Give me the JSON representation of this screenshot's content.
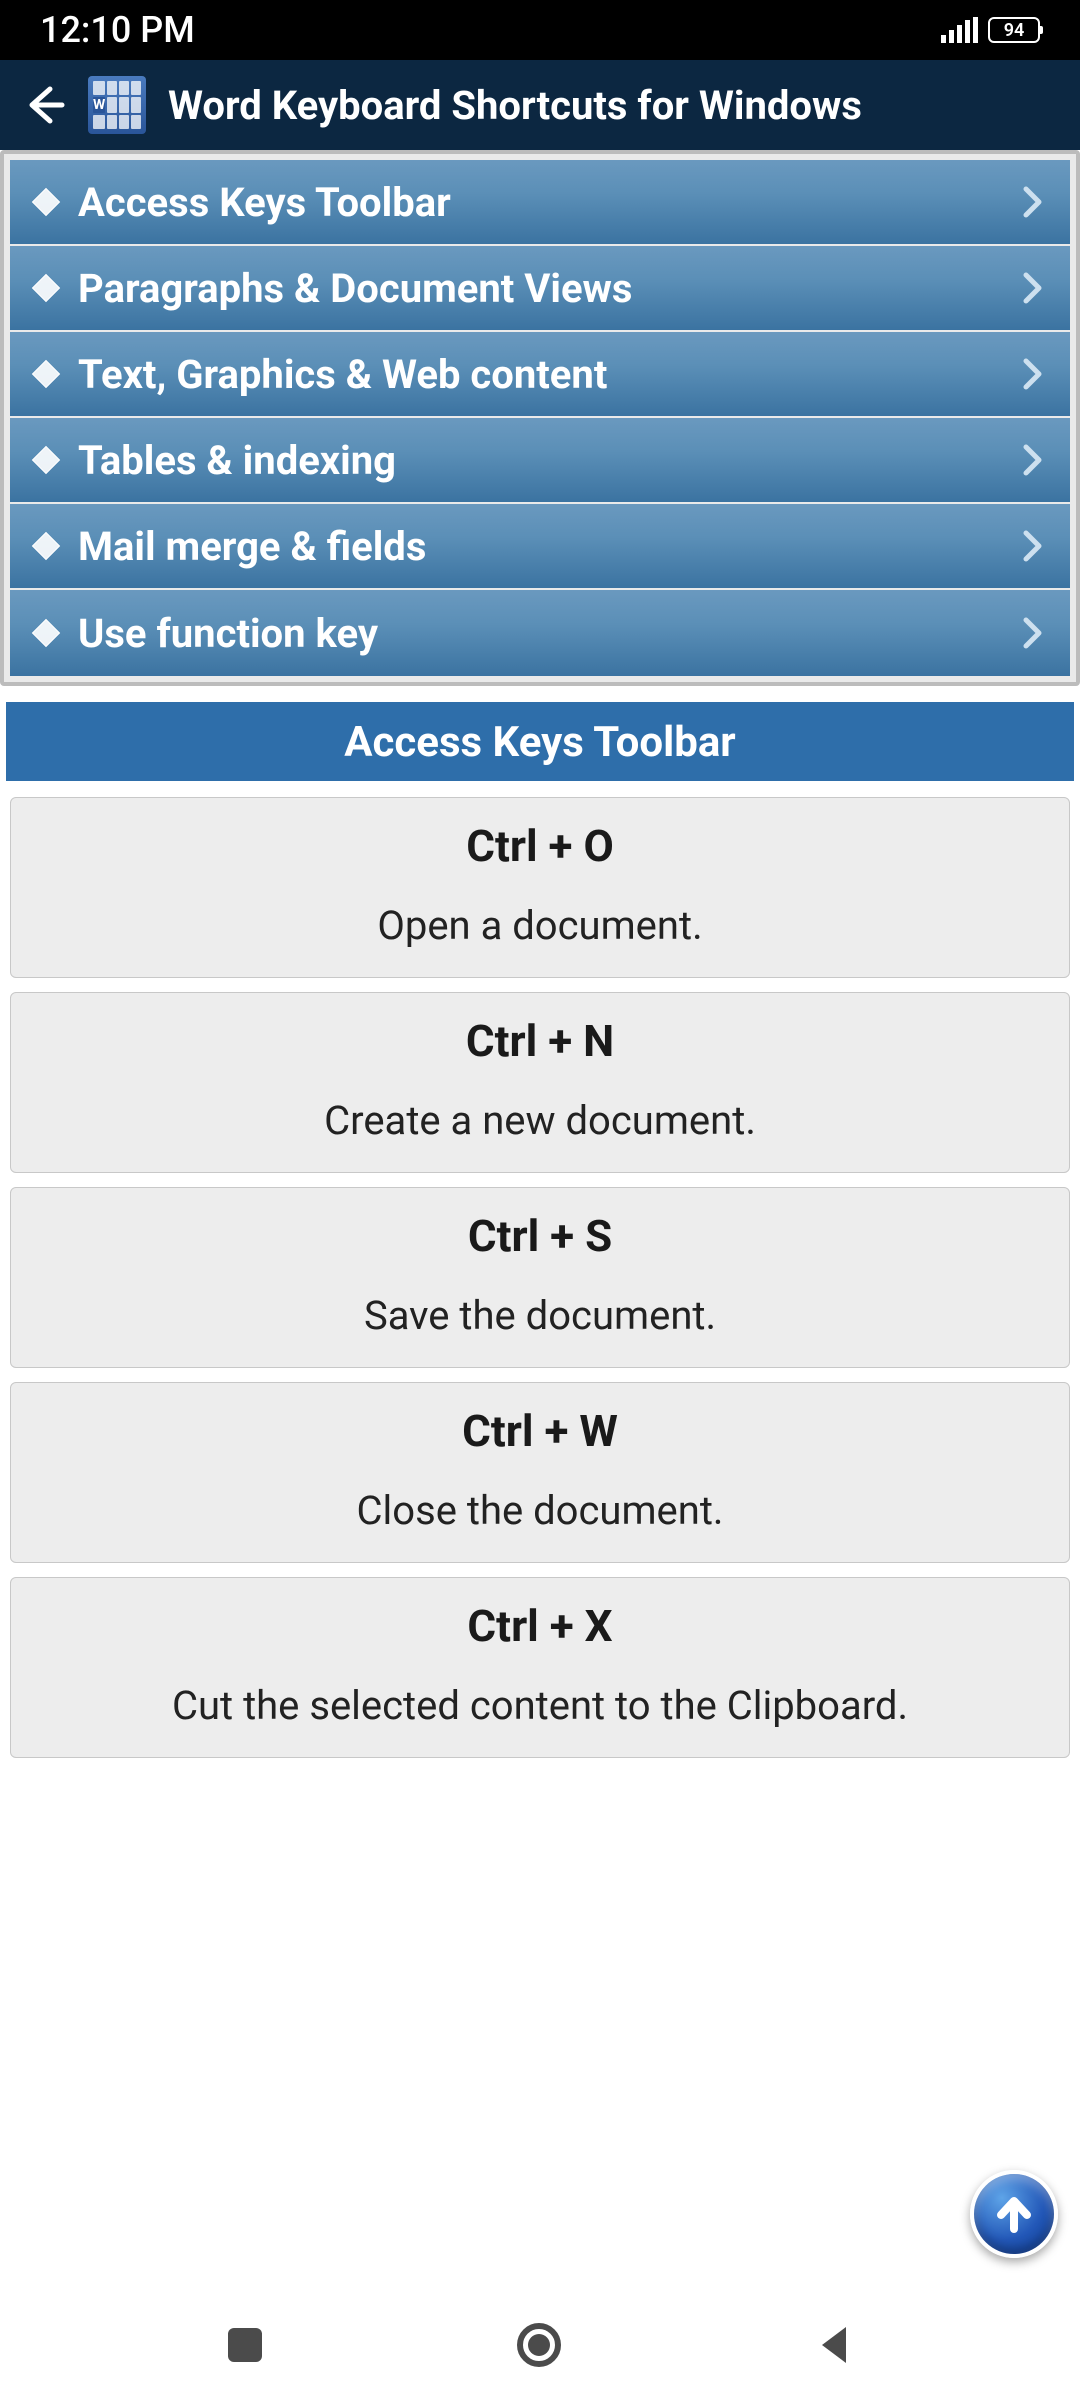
{
  "status": {
    "time": "12:10 PM",
    "battery": "94"
  },
  "header": {
    "title": "Word Keyboard Shortcuts for Windows"
  },
  "categories": [
    {
      "label": "Access Keys Toolbar"
    },
    {
      "label": "Paragraphs & Document Views"
    },
    {
      "label": "Text, Graphics & Web content"
    },
    {
      "label": "Tables & indexing"
    },
    {
      "label": "Mail merge & fields"
    },
    {
      "label": "Use function key"
    }
  ],
  "section": {
    "title": "Access Keys Toolbar"
  },
  "shortcuts": [
    {
      "key": "Ctrl + O",
      "desc": "Open a document."
    },
    {
      "key": "Ctrl + N",
      "desc": "Create a new document."
    },
    {
      "key": "Ctrl + S",
      "desc": "Save the document."
    },
    {
      "key": "Ctrl + W",
      "desc": "Close the document."
    },
    {
      "key": "Ctrl + X",
      "desc": "Cut the selected content to the Clipboard."
    }
  ]
}
